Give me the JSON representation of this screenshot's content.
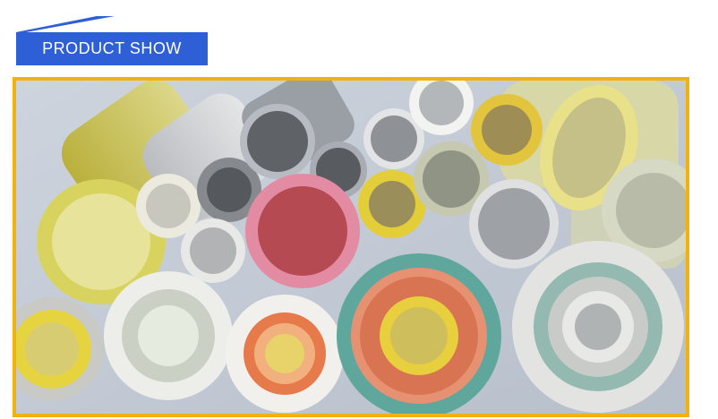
{
  "header": {
    "title": "PRODUCT SHOW",
    "color": "#2e5fd6"
  },
  "photo": {
    "frame_color": "#f3b10f",
    "subject": "fiberglass-tubes-image"
  }
}
